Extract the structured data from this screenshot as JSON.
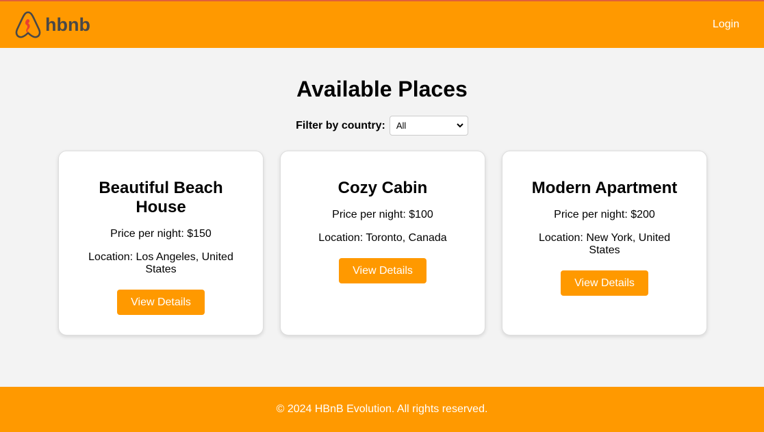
{
  "header": {
    "logo_text": "hbnb",
    "login_label": "Login"
  },
  "main": {
    "title": "Available Places",
    "filter_label": "Filter by country:",
    "filter_value": "All",
    "places": [
      {
        "name": "Beautiful Beach House",
        "price": "Price per night: $150",
        "location": "Location: Los Angeles, United States",
        "button": "View Details"
      },
      {
        "name": "Cozy Cabin",
        "price": "Price per night: $100",
        "location": "Location: Toronto, Canada",
        "button": "View Details"
      },
      {
        "name": "Modern Apartment",
        "price": "Price per night: $200",
        "location": "Location: New York, United States",
        "button": "View Details"
      }
    ]
  },
  "footer": {
    "text": "© 2024 HBnB Evolution. All rights reserved."
  },
  "colors": {
    "brand": "#ff9900",
    "background": "#f3f3f3"
  }
}
